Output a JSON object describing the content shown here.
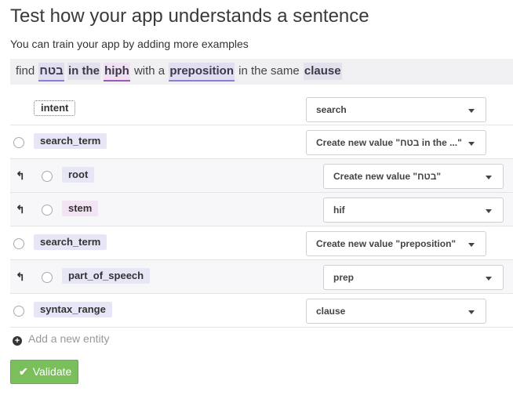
{
  "header": {
    "title": "Test how your app understands a sentence",
    "subtitle": "You can train your app by adding more examples"
  },
  "sentence": {
    "words": [
      {
        "text": "find",
        "entity": false
      },
      {
        "text": "בטח",
        "entity": true,
        "style": "purple"
      },
      {
        "text": "in the",
        "entity": true,
        "style": "plain"
      },
      {
        "text": "hiph",
        "entity": true,
        "style": "pink"
      },
      {
        "text": "with a",
        "entity": false
      },
      {
        "text": "preposition",
        "entity": true,
        "style": "purple"
      },
      {
        "text": "in the same",
        "entity": false
      },
      {
        "text": "clause",
        "entity": true,
        "style": "plain"
      }
    ]
  },
  "rows": [
    {
      "tag": "intent",
      "value": "search"
    },
    {
      "tag": "search_term",
      "value": "Create new value \"בטח in the ...\""
    },
    {
      "tag": "root",
      "value": "Create new value \"בטח\""
    },
    {
      "tag": "stem",
      "value": "hif"
    },
    {
      "tag": "search_term",
      "value": "Create new value \"preposition\""
    },
    {
      "tag": "part_of_speech",
      "value": "prep"
    },
    {
      "tag": "syntax_range",
      "value": "clause"
    }
  ],
  "add_entity": {
    "label": "Add a new entity"
  },
  "validate": {
    "label": "Validate"
  },
  "icons": {
    "sub_arrow": "subdirectory-arrow-icon",
    "plus": "plus-circle-icon",
    "check": "check-icon",
    "caret": "caret-down-icon"
  },
  "colors": {
    "validate_bg": "#7bbf5c",
    "entity_underline": "#8a7fd6",
    "pink_underline": "#9b59b6"
  }
}
